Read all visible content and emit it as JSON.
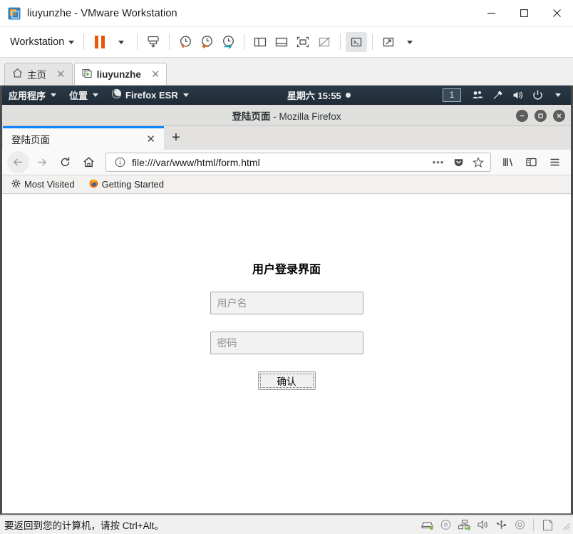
{
  "window": {
    "title": "liuyunzhe - VMware Workstation",
    "app_icon": "vmware-logo-icon",
    "controls": {
      "minimize": "—",
      "maximize": "□",
      "close": "✕"
    }
  },
  "toolbar": {
    "workstation_label": "Workstation",
    "items": [
      {
        "name": "pause-vm-button",
        "icon": "pause-icon"
      },
      {
        "name": "power-dropdown-button",
        "icon": "caret-down-icon"
      },
      {
        "name": "send-ctrl-alt-del-button",
        "icon": "keyboard-send-icon"
      },
      {
        "name": "take-snapshot-button",
        "icon": "clock-plus-icon"
      },
      {
        "name": "revert-snapshot-button",
        "icon": "clock-back-icon"
      },
      {
        "name": "snapshot-manager-button",
        "icon": "clock-wrench-icon"
      },
      {
        "name": "show-library-button",
        "icon": "library-panel-icon"
      },
      {
        "name": "show-thumbnails-button",
        "icon": "thumbnail-bar-icon"
      },
      {
        "name": "fullscreen-button",
        "icon": "fullscreen-icon"
      },
      {
        "name": "unity-mode-button",
        "icon": "unity-mode-icon"
      },
      {
        "name": "console-view-button",
        "icon": "console-icon"
      },
      {
        "name": "stretch-guest-button",
        "icon": "expand-arrows-icon"
      },
      {
        "name": "stretch-dropdown-button",
        "icon": "caret-down-icon"
      }
    ]
  },
  "vm_tabs": [
    {
      "label": "主页",
      "icon": "home-icon",
      "active": false
    },
    {
      "label": "liuyunzhe",
      "icon": "vm-running-icon",
      "active": true
    }
  ],
  "guest": {
    "gnome_panel": {
      "applications": "应用程序",
      "places": "位置",
      "firefox": "Firefox ESR",
      "clock": "星期六 15:55",
      "workspace": "1",
      "tray": [
        {
          "name": "users-icon"
        },
        {
          "name": "network-tools-icon"
        },
        {
          "name": "volume-icon"
        },
        {
          "name": "power-icon"
        },
        {
          "name": "caret-down-icon"
        }
      ]
    },
    "firefox": {
      "window_title_page": "登陆页面",
      "window_title_suffix": " - Mozilla Firefox",
      "window_controls": {
        "minimize": "–",
        "maximize": "□",
        "close": "✕"
      },
      "tab": {
        "title": "登陆页面",
        "close": "✕"
      },
      "new_tab": "+",
      "nav": {
        "back": "back-icon",
        "forward": "forward-icon",
        "reload": "reload-icon",
        "home": "home-icon"
      },
      "url": "file:///var/www/html/form.html",
      "url_actions": [
        {
          "name": "page-actions-icon",
          "glyph": "•••"
        },
        {
          "name": "pocket-icon"
        },
        {
          "name": "bookmark-star-icon"
        }
      ],
      "toolbar_right": [
        {
          "name": "library-icon"
        },
        {
          "name": "sidebar-icon"
        },
        {
          "name": "hamburger-menu-icon"
        }
      ],
      "bookmarks": [
        {
          "label": "Most Visited",
          "icon": "gear-icon"
        },
        {
          "label": "Getting Started",
          "icon": "firefox-icon"
        }
      ]
    },
    "page": {
      "heading": "用户登录界面",
      "username_placeholder": "用户名",
      "username_value": "",
      "password_placeholder": "密码",
      "password_value": "",
      "submit_label": "确认"
    }
  },
  "statusbar": {
    "hint": "要返回到您的计算机，请按 Ctrl+Alt。",
    "devices": [
      {
        "name": "hard-disk-icon",
        "active": true
      },
      {
        "name": "cd-dvd-icon",
        "active": false
      },
      {
        "name": "network-adapter-icon",
        "active": true
      },
      {
        "name": "sound-card-icon",
        "active": false
      },
      {
        "name": "usb-device-icon",
        "active": false
      },
      {
        "name": "printer-icon",
        "active": false
      },
      {
        "name": "display-icon",
        "active": false
      }
    ]
  },
  "colors": {
    "accent_orange": "#e8590c",
    "firefox_tab_accent": "#0a84ff",
    "panel_dark": "#22313f",
    "status_green": "#7ac143"
  }
}
